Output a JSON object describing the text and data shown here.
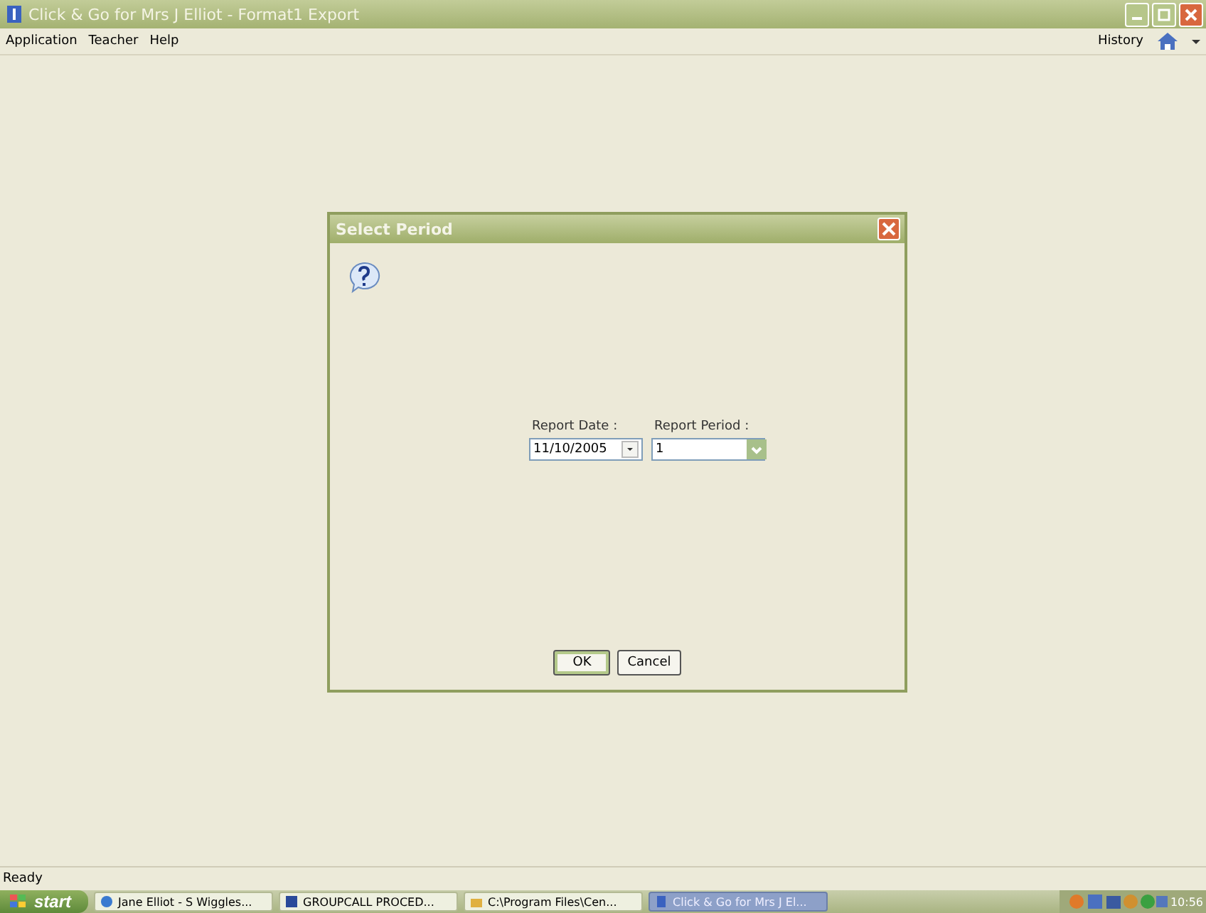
{
  "window": {
    "title": "Click & Go for Mrs J Elliot - Format1 Export"
  },
  "menu": [
    "Application",
    "Teacher",
    "Help"
  ],
  "toolbar": {
    "history": "History"
  },
  "dialog": {
    "title": "Select Period",
    "fields": [
      {
        "label": "Report Date :",
        "value": "11/10/2005",
        "kind": "date"
      },
      {
        "label": "Report Period :",
        "value": "1",
        "kind": "combo"
      }
    ],
    "buttons": [
      {
        "label": "OK",
        "default": true
      },
      {
        "label": "Cancel",
        "default": false
      }
    ]
  },
  "status_bar": "Ready",
  "taskbar": {
    "start": "start",
    "items": [
      {
        "label": "Jane Elliot - S Wiggles...",
        "selected": false
      },
      {
        "label": "GROUPCALL PROCED...",
        "selected": false
      },
      {
        "label": "C:\\Program Files\\Cen...",
        "selected": false
      },
      {
        "label": "Click & Go for Mrs J El...",
        "selected": true
      }
    ],
    "clock": "10:56"
  }
}
